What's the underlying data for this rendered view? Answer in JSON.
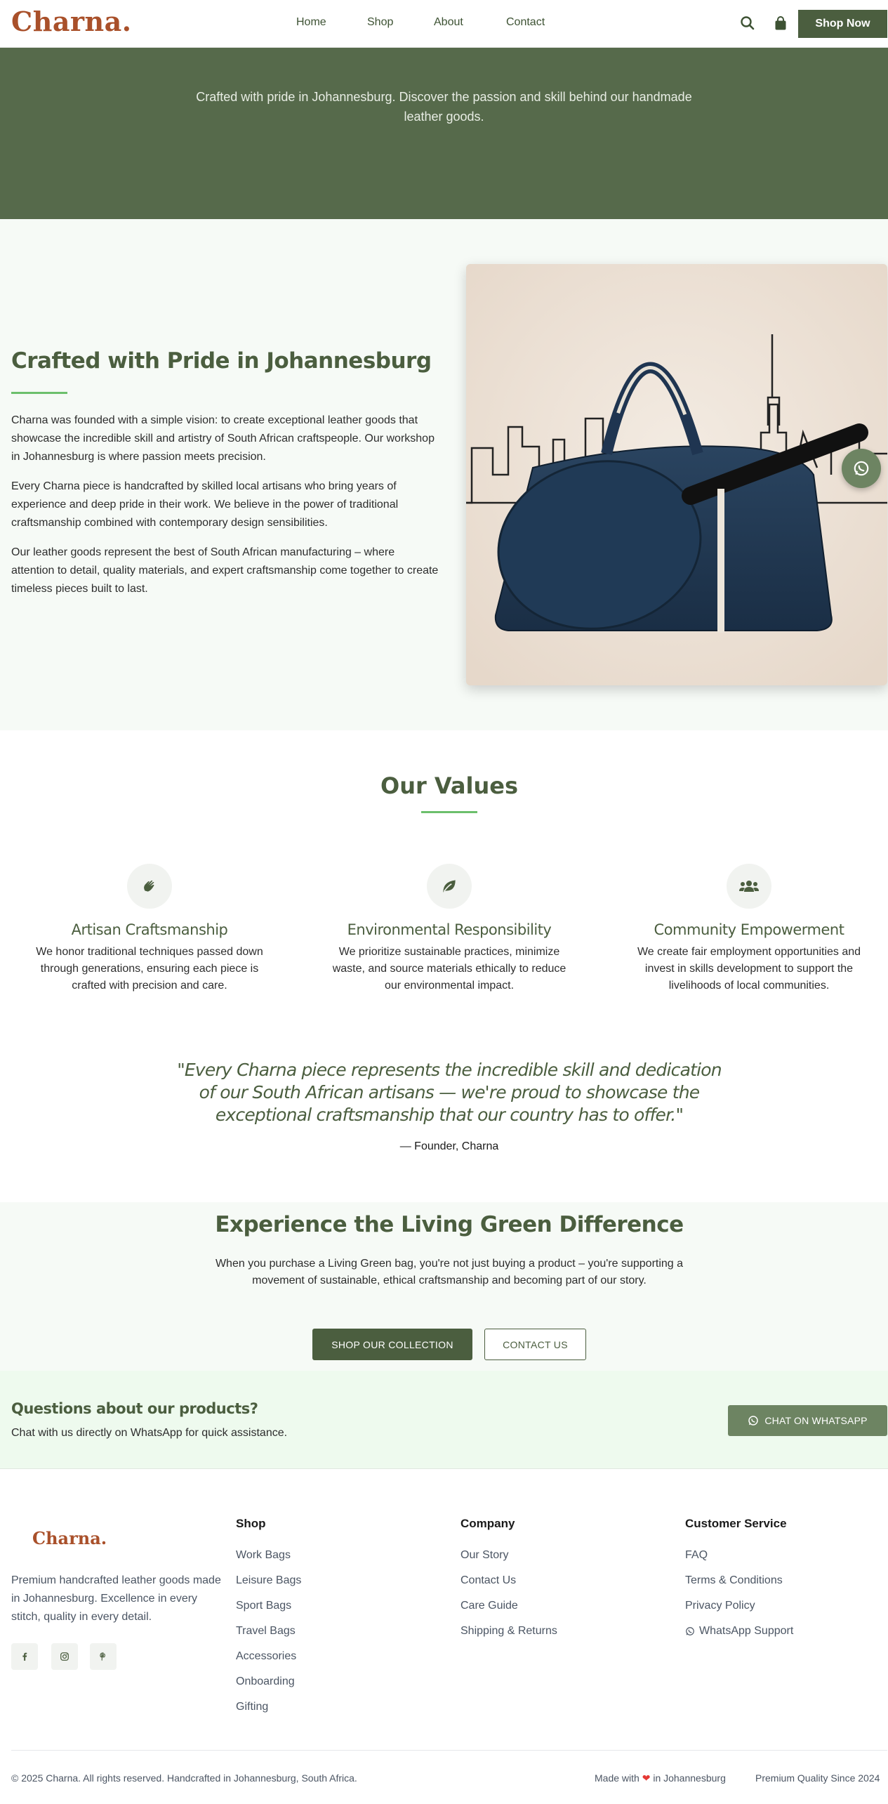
{
  "colors": {
    "brand": "#a9502a",
    "primary": "#4b5e3f",
    "hero_bg": "#566a4b",
    "accent_rule": "#6cbf6c",
    "whatsapp_btn": "#6d8462"
  },
  "header": {
    "logo": "Charna.",
    "nav": [
      "Home",
      "Shop",
      "About",
      "Contact"
    ],
    "search_icon": "search-icon",
    "cart_icon": "shopping-bag-icon",
    "cta": "Shop Now"
  },
  "hero": {
    "subtitle": "Crafted with pride in Johannesburg. Discover the passion and skill behind our handmade leather goods."
  },
  "story": {
    "title": "Crafted with Pride in Johannesburg",
    "paragraphs": [
      "Charna was founded with a simple vision: to create exceptional leather goods that showcase the incredible skill and artistry of South African craftspeople. Our workshop in Johannesburg is where passion meets precision.",
      "Every Charna piece is handcrafted by skilled local artisans who bring years of experience and deep pride in their work. We believe in the power of traditional craftsmanship combined with contemporary design sensibilities.",
      "Our leather goods represent the best of South African manufacturing – where attention to detail, quality materials, and expert craftsmanship come together to create timeless pieces built to last."
    ],
    "image_icon": "navy-sport-bag-image"
  },
  "values": {
    "title": "Our Values",
    "items": [
      {
        "icon": "hands-icon",
        "title": "Artisan Craftsmanship",
        "text": "We honor traditional techniques passed down through generations, ensuring each piece is crafted with precision and care."
      },
      {
        "icon": "leaf-icon",
        "title": "Environmental Responsibility",
        "text": "We prioritize sustainable practices, minimize waste, and source materials ethically to reduce our environmental impact."
      },
      {
        "icon": "people-icon",
        "title": "Community Empowerment",
        "text": "We create fair employment opportunities and invest in skills development to support the livelihoods of local communities."
      }
    ]
  },
  "quote": {
    "text": "\"Every Charna piece represents the incredible skill and dedication of our South African artisans — we're proud to showcase the exceptional craftsmanship that our country has to offer.\"",
    "author": "— Founder, Charna"
  },
  "cta": {
    "title": "Experience the Living Green Difference",
    "text": "When you purchase a Living Green bag, you're not just buying a product – you're supporting a movement of sustainable, ethical craftsmanship and becoming part of our story.",
    "primary": "SHOP OUR COLLECTION",
    "secondary": "CONTACT US"
  },
  "whatsapp": {
    "title": "Questions about our products?",
    "text": "Chat with us directly on WhatsApp for quick assistance.",
    "button": "CHAT ON WHATSAPP"
  },
  "footer": {
    "logo": "Charna.",
    "description": "Premium handcrafted leather goods made in Johannesburg. Excellence in every stitch, quality in every detail.",
    "social": [
      "facebook-icon",
      "instagram-icon",
      "pinterest-icon"
    ],
    "shop": {
      "title": "Shop",
      "links": [
        "Work Bags",
        "Leisure Bags",
        "Sport Bags",
        "Travel Bags",
        "Accessories",
        "Onboarding",
        "Gifting"
      ]
    },
    "company": {
      "title": "Company",
      "links": [
        "Our Story",
        "Contact Us",
        "Care Guide",
        "Shipping & Returns"
      ]
    },
    "service": {
      "title": "Customer Service",
      "links": [
        "FAQ",
        "Terms & Conditions",
        "Privacy Policy",
        "WhatsApp Support"
      ]
    },
    "copyright": "© 2025 Charna. All rights reserved. Handcrafted in Johannesburg, South Africa.",
    "made_with_prefix": "Made with",
    "made_with_suffix": "in Johannesburg",
    "quality": "Premium Quality Since 2024"
  }
}
